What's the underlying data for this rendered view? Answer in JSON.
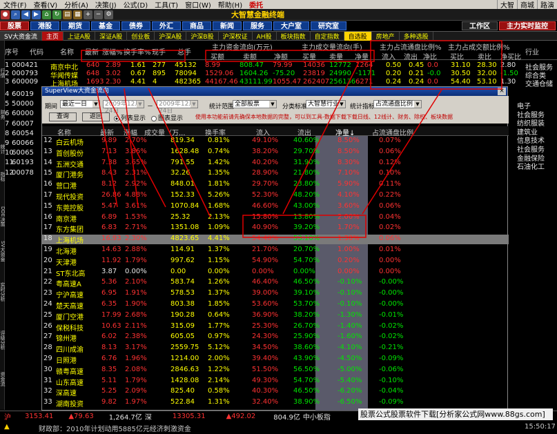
{
  "menu": {
    "items": [
      "文件(F)",
      "查看(V)",
      "分析(A)",
      "决策(J)",
      "公式(D)",
      "工具(T)",
      "窗口(W)",
      "帮助(H)"
    ],
    "brand": "委托",
    "right": [
      "大智",
      "商城",
      "路演"
    ]
  },
  "toolbar": {
    "logo": "大智慧金融终端"
  },
  "nav": {
    "buttons": [
      "股票",
      "港股",
      "期货",
      "基金",
      "债券",
      "外汇",
      "商品",
      "新闻",
      "服务",
      "大户室",
      "研究室"
    ],
    "right": [
      "工作区",
      "主力实时监控"
    ]
  },
  "sectors": [
    "SV大资金流",
    "主页",
    "上证A股",
    "深证A股",
    "创业板",
    "沪深A股",
    "沪深B股",
    "沪深权证",
    "AH股",
    "板块指数",
    "自定指数",
    "自选股",
    "房地产",
    "多种选股"
  ],
  "main_table": {
    "headers": {
      "row_label": "行情",
      "seq": "序号",
      "code": "代码",
      "name": "名称",
      "latest": "最新",
      "change_pct": "涨幅%",
      "turnover_pct": "换手率%",
      "hand": "现手",
      "amount": "总手",
      "group1": "主力资金流向(万元)",
      "g1a": "买额",
      "g1b": "卖额",
      "g1c": "净额",
      "group2": "主力成交量流向(手)",
      "g2a": "买量",
      "g2b": "卖量",
      "g2c": "净量",
      "group3": "主力占流通盘比例%",
      "g3a": "流入",
      "g3b": "流出",
      "g3c": "净比",
      "group4": "主力占成交额比例%",
      "g4a": "买比",
      "g4b": "卖比",
      "g4c": "净买比",
      "industry": "行业"
    },
    "rows": [
      {
        "seq": "1",
        "code": "000421",
        "name": "南京中北",
        "latest": "640",
        "chg": "2.89",
        "turn": "1.61",
        "hand": "277",
        "amount": "45132",
        "buy_amt": "8.99",
        "sell_amt": "808.47",
        "net_amt": "79.99",
        "buy_vol": "14036",
        "sell_vol": "12772",
        "net_vol": "1264",
        "in": "0.50",
        "out": "0.45",
        "net_ratio": "0.0",
        "buy_r": "31.10",
        "sell_r": "28.30",
        "netbuy_r": "2.80",
        "industry": "社会服务"
      },
      {
        "seq": "2",
        "code": "000793",
        "name": "华闻传媒",
        "latest": "648",
        "chg": "3.02",
        "turn": "0.67",
        "hand": "895",
        "amount": "78094",
        "buy_amt": "1529.06",
        "sell_amt": "1604.26",
        "net_amt": "-75.20",
        "buy_vol": "23819",
        "sell_vol": "24990",
        "net_vol": "-1171",
        "in": "0.20",
        "out": "0.21",
        "net_ratio": "-0.0",
        "buy_r": "30.50",
        "sell_r": "32.00",
        "netbuy_r": "-1.50",
        "industry": "综合类"
      },
      {
        "seq": "3",
        "code": "600009",
        "name": "上海机场",
        "latest": "1693",
        "chg": "2.30",
        "turn": "4.41",
        "hand": "4",
        "amount": "482365",
        "buy_amt": "44167.46",
        "sell_amt": "43111.99",
        "net_amt": "1055.47",
        "buy_vol": "262407",
        "sell_vol": "256136",
        "net_vol": "6271",
        "in": "0.24",
        "out": "0.24",
        "net_ratio": "0.0",
        "buy_r": "54.40",
        "sell_r": "53.10",
        "netbuy_r": "1.30",
        "industry": "交通仓储"
      }
    ],
    "partial_codes": [
      "60019",
      "50000",
      "60000",
      "60007",
      "60054",
      "60066",
      "60065",
      "60193",
      "00078"
    ],
    "right_industries": [
      "电子",
      "社会服务",
      "纺织服装",
      "建筑业",
      "信息技术",
      "社会服务",
      "金融保险",
      "石油化工"
    ]
  },
  "popup": {
    "title": "SuperView大资金流向",
    "period_label": "期间",
    "period_value": "最近一日",
    "date_from": "2009年12月24日",
    "date_to": "2009年12月24日",
    "range_label": "统计范围",
    "range_value": "全部股票",
    "class_label": "分类标准",
    "class_value": "大智慧行业",
    "indicator_label": "统计指标",
    "indicator_value": "占流通盘比例",
    "query_btn": "查询",
    "back_btn": "返回",
    "radio_list": "列表显示",
    "radio_chart": "图表显示",
    "note": "使用本功能前请先确保本地数据的完整，可以到工具-数据下载下载日线、12线计、财务、除权、板块数据",
    "columns": [
      "名称",
      "最新",
      "涨幅",
      "成交量（万...",
      "换手率",
      "流入",
      "流出",
      "净量↓",
      "占流通盘比例"
    ],
    "rows": [
      {
        "n": "12",
        "name": "白云机场",
        "latest": "9.89",
        "chg": "2.70%",
        "vol": "819.34",
        "turn": "0.81%",
        "in": "49.10%",
        "out": "40.60%",
        "net": "8.50%",
        "ratio": "0.07%"
      },
      {
        "n": "13",
        "name": "首创股份",
        "latest": "7.13",
        "chg": "3.86%",
        "vol": "1628.48",
        "turn": "0.74%",
        "in": "38.20%",
        "out": "29.70%",
        "net": "8.50%",
        "ratio": "0.06%"
      },
      {
        "n": "14",
        "name": "五洲交通",
        "latest": "7.38",
        "chg": "3.65%",
        "vol": "791.55",
        "turn": "1.42%",
        "in": "40.20%",
        "out": "31.90%",
        "net": "8.30%",
        "ratio": "0.12%"
      },
      {
        "n": "15",
        "name": "厦门港务",
        "latest": "8.43",
        "chg": "2.31%",
        "vol": "32.26",
        "turn": "1.35%",
        "in": "28.90%",
        "out": "21.80%",
        "net": "7.10%",
        "ratio": "0.10%"
      },
      {
        "n": "16",
        "name": "营口港",
        "latest": "8.12",
        "chg": "2.92%",
        "vol": "848.01",
        "turn": "1.81%",
        "in": "29.70%",
        "out": "23.80%",
        "net": "5.90%",
        "ratio": "0.11%"
      },
      {
        "n": "17",
        "name": "现代投资",
        "latest": "26.86",
        "chg": "4.88%",
        "vol": "152.33",
        "turn": "5.26%",
        "in": "52.30%",
        "out": "48.20%",
        "net": "4.10%",
        "ratio": "0.22%"
      },
      {
        "n": "15",
        "name": "东莞控股",
        "latest": "5.47",
        "chg": "3.61%",
        "vol": "1070.84",
        "turn": "1.68%",
        "in": "46.60%",
        "out": "43.00%",
        "net": "3.60%",
        "ratio": "0.06%"
      },
      {
        "n": "16",
        "name": "南京港",
        "latest": "6.89",
        "chg": "1.53%",
        "vol": "25.32",
        "turn": "2.13%",
        "in": "15.80%",
        "out": "13.80%",
        "net": "2.00%",
        "ratio": "0.04%"
      },
      {
        "n": "17",
        "name": "东方集团",
        "latest": "6.83",
        "chg": "2.71%",
        "vol": "1351.08",
        "turn": "1.09%",
        "in": "40.90%",
        "out": "39.20%",
        "net": "1.70%",
        "ratio": "0.02%"
      },
      {
        "n": "18",
        "name": "上海机场",
        "latest": "16.93",
        "chg": "2.30%",
        "vol": "4823.65",
        "turn": "4.41%",
        "in": "54.40%",
        "out": "53.10%",
        "net": "1.30%",
        "ratio": "0.06%"
      },
      {
        "n": "19",
        "name": "北海港",
        "latest": "14.63",
        "chg": "2.88%",
        "vol": "114.91",
        "turn": "1.37%",
        "in": "21.70%",
        "out": "20.70%",
        "net": "1.00%",
        "ratio": "0.01%"
      },
      {
        "n": "20",
        "name": "天津港",
        "latest": "11.92",
        "chg": "1.79%",
        "vol": "997.62",
        "turn": "1.15%",
        "in": "54.90%",
        "out": "54.70%",
        "net": "0.20%",
        "ratio": "0.00%"
      },
      {
        "n": "21",
        "name": "ST东北高",
        "latest": "3.87",
        "chg": "0.00%",
        "vol": "0.00",
        "turn": "0.00%",
        "in": "0.00%",
        "out": "0.00%",
        "net": "0.00%",
        "ratio": "0.00%"
      },
      {
        "n": "22",
        "name": "粤高速A",
        "latest": "5.36",
        "chg": "2.10%",
        "vol": "583.74",
        "turn": "1.26%",
        "in": "46.40%",
        "out": "46.50%",
        "net": "-0.10%",
        "ratio": "-0.00%"
      },
      {
        "n": "23",
        "name": "宁沪高速",
        "latest": "6.95",
        "chg": "1.91%",
        "vol": "578.53",
        "turn": "1.37%",
        "in": "39.00%",
        "out": "39.10%",
        "net": "-0.10%",
        "ratio": "-0.00%"
      },
      {
        "n": "24",
        "name": "楚天高速",
        "latest": "6.35",
        "chg": "1.90%",
        "vol": "803.38",
        "turn": "1.85%",
        "in": "53.60%",
        "out": "53.70%",
        "net": "-0.10%",
        "ratio": "-0.00%"
      },
      {
        "n": "25",
        "name": "厦门空港",
        "latest": "17.99",
        "chg": "2.68%",
        "vol": "190.28",
        "turn": "0.64%",
        "in": "36.90%",
        "out": "38.20%",
        "net": "-1.30%",
        "ratio": "-0.01%"
      },
      {
        "n": "26",
        "name": "保税科技",
        "latest": "10.63",
        "chg": "2.11%",
        "vol": "315.09",
        "turn": "1.77%",
        "in": "25.30%",
        "out": "26.70%",
        "net": "-1.40%",
        "ratio": "-0.02%"
      },
      {
        "n": "27",
        "name": "锦州港",
        "latest": "6.02",
        "chg": "2.38%",
        "vol": "605.05",
        "turn": "0.97%",
        "in": "24.30%",
        "out": "25.90%",
        "net": "-1.60%",
        "ratio": "-0.02%"
      },
      {
        "n": "28",
        "name": "四川成渝",
        "latest": "8.13",
        "chg": "3.17%",
        "vol": "2559.75",
        "turn": "5.12%",
        "in": "34.50%",
        "out": "38.60%",
        "net": "-4.10%",
        "ratio": "-0.21%"
      },
      {
        "n": "29",
        "name": "日照港",
        "latest": "6.76",
        "chg": "1.96%",
        "vol": "1214.00",
        "turn": "2.00%",
        "in": "39.40%",
        "out": "43.90%",
        "net": "-4.50%",
        "ratio": "-0.09%"
      },
      {
        "n": "30",
        "name": "赣粤高速",
        "latest": "8.35",
        "chg": "2.08%",
        "vol": "2846.63",
        "turn": "1.22%",
        "in": "51.50%",
        "out": "56.50%",
        "net": "-5.00%",
        "ratio": "-0.06%"
      },
      {
        "n": "31",
        "name": "山东高速",
        "latest": "5.11",
        "chg": "1.79%",
        "vol": "1428.08",
        "turn": "2.14%",
        "in": "49.30%",
        "out": "54.70%",
        "net": "-5.40%",
        "ratio": "-0.10%"
      },
      {
        "n": "32",
        "name": "深高速",
        "latest": "5.25",
        "chg": "2.09%",
        "vol": "825.40",
        "turn": "0.58%",
        "in": "40.30%",
        "out": "46.50%",
        "net": "-6.20%",
        "ratio": "-0.04%"
      },
      {
        "n": "33",
        "name": "湖南投资",
        "latest": "9.82",
        "chg": "1.97%",
        "vol": "522.84",
        "turn": "1.31%",
        "in": "32.40%",
        "out": "38.90%",
        "net": "-6.50%",
        "ratio": "-0.09%"
      }
    ]
  },
  "status": {
    "sh_label": "沪",
    "sh_index": "3153.41",
    "sh_change": "▲79.63",
    "sh_amount": "1,264.7亿",
    "sz_label": "深",
    "sz_index": "13305.31",
    "sz_change": "▲492.02",
    "sz_amount": "804.9亿",
    "board": "中小板指",
    "ticker": "财政部：2010年计划动用5885亿元经济刺激资金",
    "time": "15:50:17"
  },
  "watermark": "股票公式股票软件下载[分析家公式网www.88gs.com]",
  "colors": {
    "up": "#ff3232",
    "down": "#00e600",
    "highlight": "#ffff00",
    "annotation": "#e00000"
  }
}
